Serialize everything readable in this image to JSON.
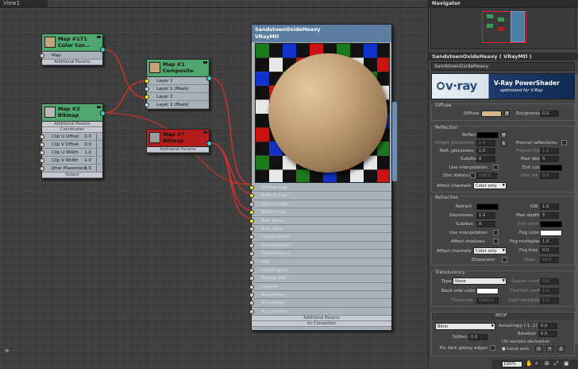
{
  "view": {
    "tab": "View1"
  },
  "navigator": {
    "title": "Navigator"
  },
  "nodes": {
    "map171": {
      "title": "Map #171",
      "subtitle": "Color Cor...",
      "slot": "Map",
      "band": "Additional Params"
    },
    "map2": {
      "title": "Map #2",
      "subtitle": "Bitmap",
      "band_top": "Additional Params",
      "band_coords": "Coordinates",
      "slots": [
        {
          "label": "Clip U Offset",
          "value": "0.0"
        },
        {
          "label": "Clip V Offset",
          "value": "0.0"
        },
        {
          "label": "Clip U Width",
          "value": "1.0"
        },
        {
          "label": "Clip V Width",
          "value": "1.0"
        },
        {
          "label": "Jitter Placement",
          "value": "1.0"
        }
      ],
      "band_output": "Output"
    },
    "map1": {
      "title": "Map #1",
      "subtitle": "Composite",
      "slots": [
        "Layer 1",
        "Layer 1 (Mask)",
        "Layer 2",
        "Layer 2 (Mask)"
      ]
    },
    "map_red": {
      "title": "Map #?",
      "subtitle": "Bitmap",
      "band": "Additional Params"
    },
    "material": {
      "title": "SandstoenOxideHeavy",
      "subtitle": "VRayMtl",
      "slots": [
        "Diffuse map",
        "Reflect map",
        "Refract map",
        "Bump map",
        "Refl. gloss",
        "Refr. gloss",
        "Displacement",
        "Environment",
        "Translucency",
        "IOR",
        "Hilight gloss",
        "Fresnel IOR",
        "Opacity",
        "Roughness",
        "Anisotropy",
        "An. rotation"
      ],
      "band1": "Additional Params",
      "band2": "mr Connection"
    }
  },
  "panel": {
    "title": "SandstoenOxideHeavy  ( VRayMtl )",
    "name": "SandstoenOxideHeavy",
    "banner": {
      "logo": "v·ray",
      "line1": "V-Ray PowerShader",
      "line2": "optimized for V-Ray"
    },
    "diffuse": {
      "group": "Diffuse",
      "diffuse_label": "Diffuse",
      "m": "M",
      "roughness_label": "Roughness",
      "roughness": "0.0",
      "color": "#d8b48e"
    },
    "reflection": {
      "group": "Reflection",
      "reflect_label": "Reflect",
      "m": "M",
      "hilight_label": "Hilight glossiness",
      "hilight": "1.0",
      "l": "L",
      "fresnel_label": "Fresnel reflections",
      "refl_gloss_label": "Refl. glossiness",
      "refl_gloss": "1.0",
      "fresnel_ior_label": "Fresnel IOR",
      "fresnel_ior": "1.6",
      "subdivs_label": "Subdivs",
      "subdivs": "8",
      "max_depth_label": "Max depth",
      "max_depth": "5",
      "use_interp_label": "Use interpolation",
      "exit_color_label": "Exit color",
      "dim_distance_label": "Dim distance",
      "dim_distance": "100.0",
      "dim_falloff_label": "Dim fall off",
      "dim_falloff": "0.0",
      "affect_label": "Affect channels",
      "affect": "Color only"
    },
    "refraction": {
      "group": "Refraction",
      "refract_label": "Refract",
      "ior_label": "IOR",
      "ior": "1.6",
      "gloss_label": "Glossiness",
      "gloss": "1.0",
      "max_depth_label": "Max depth",
      "max_depth": "5",
      "subdivs_label": "Subdivs",
      "subdivs": "8",
      "exit_color_label": "Exit color",
      "use_interp_label": "Use interpolation",
      "fog_color_label": "Fog color",
      "affect_shadows_label": "Affect shadows",
      "fog_mult_label": "Fog multiplier",
      "fog_mult": "1.0",
      "affect_label": "Affect channels",
      "affect": "Color only",
      "fog_bias_label": "Fog bias",
      "fog_bias": "0.0",
      "dispersion_label": "Dispersion",
      "abbe_label": "Abbe",
      "abbe": "50.0"
    },
    "translucency": {
      "group": "Translucency",
      "type_label": "Type",
      "type": "None",
      "scatter_label": "Scatter coeff",
      "scatter": "0.0",
      "back_label": "Back-side color",
      "fwd_label": "Fwd/bck coeff",
      "fwd": "1.0",
      "thickness_label": "Thickness",
      "thickness": "1000.0",
      "light_label": "Light multiplier",
      "light": "1.0"
    },
    "brdf": {
      "group": "BRDF",
      "type": "Blinn",
      "aniso_label": "Anisotropy (-1..1)",
      "aniso": "0.0",
      "rotation_label": "Rotation",
      "rotation": "0.0",
      "soften_label": "Soften",
      "soften": "0.0",
      "uv_label": "UV vectors derivation",
      "fix_label": "Fix dark glossy edges",
      "local_label": "Local axis",
      "x": "X",
      "y": "Y",
      "z": "Z"
    }
  },
  "status": {
    "zoom": "100%"
  }
}
